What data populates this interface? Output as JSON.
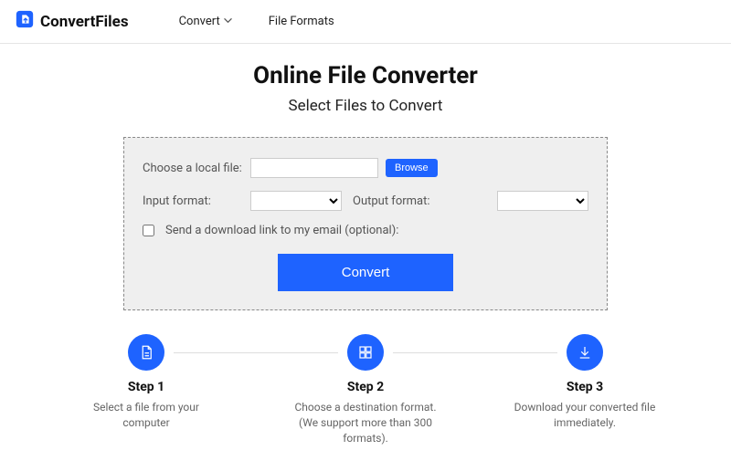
{
  "nav": {
    "brand": "ConvertFiles",
    "items": [
      "Convert",
      "File Formats"
    ]
  },
  "hero": {
    "title": "Online File Converter",
    "subtitle": "Select Files to Convert"
  },
  "form": {
    "local_file_label": "Choose a local file:",
    "browse_label": "Browse",
    "input_format_label": "Input format:",
    "output_format_label": "Output format:",
    "email_checkbox_label": "Send a download link to my email (optional):",
    "convert_label": "Convert",
    "file_value": "",
    "input_format_value": "",
    "output_format_value": ""
  },
  "steps": [
    {
      "title": "Step 1",
      "desc": "Select a file from your computer"
    },
    {
      "title": "Step 2",
      "desc": "Choose a destination format. (We support more than 300 formats)."
    },
    {
      "title": "Step 3",
      "desc": "Download your converted file immediately."
    }
  ]
}
